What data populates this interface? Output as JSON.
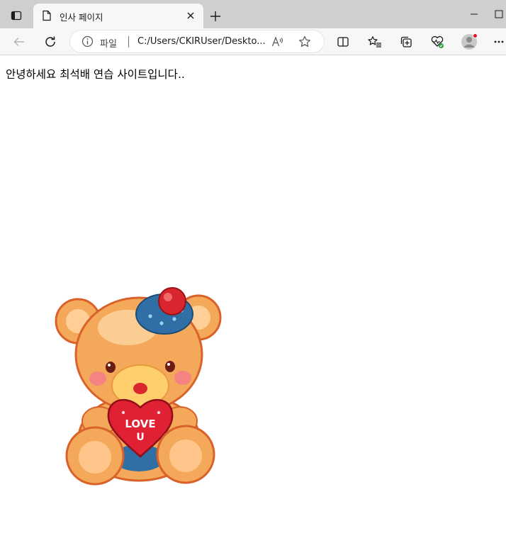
{
  "browser": {
    "tab": {
      "title": "인사 페이지",
      "favicon": "page-icon"
    },
    "address_bar": {
      "site_label": "파일",
      "url": "C:/Users/CKIRUser/Deskto..."
    },
    "toolbar_icons": [
      "back-icon",
      "refresh-icon",
      "info-icon",
      "read-aloud-icon",
      "favorite-star-icon",
      "split-screen-icon",
      "favorites-icon",
      "collections-icon",
      "browser-essentials-icon",
      "profile-icon",
      "more-icon"
    ],
    "colors": {
      "tabstrip": "#cfcfcf",
      "toolbar": "#f7f7f7",
      "profile_dot": "#e81123",
      "essentials_badge": "#2a9d3a"
    }
  },
  "page": {
    "greeting": "안녕하세요 최석배 연습 사이트입니다..",
    "image": {
      "subject": "teddy-bear-holding-heart",
      "heart_text": "LOVE U"
    }
  }
}
